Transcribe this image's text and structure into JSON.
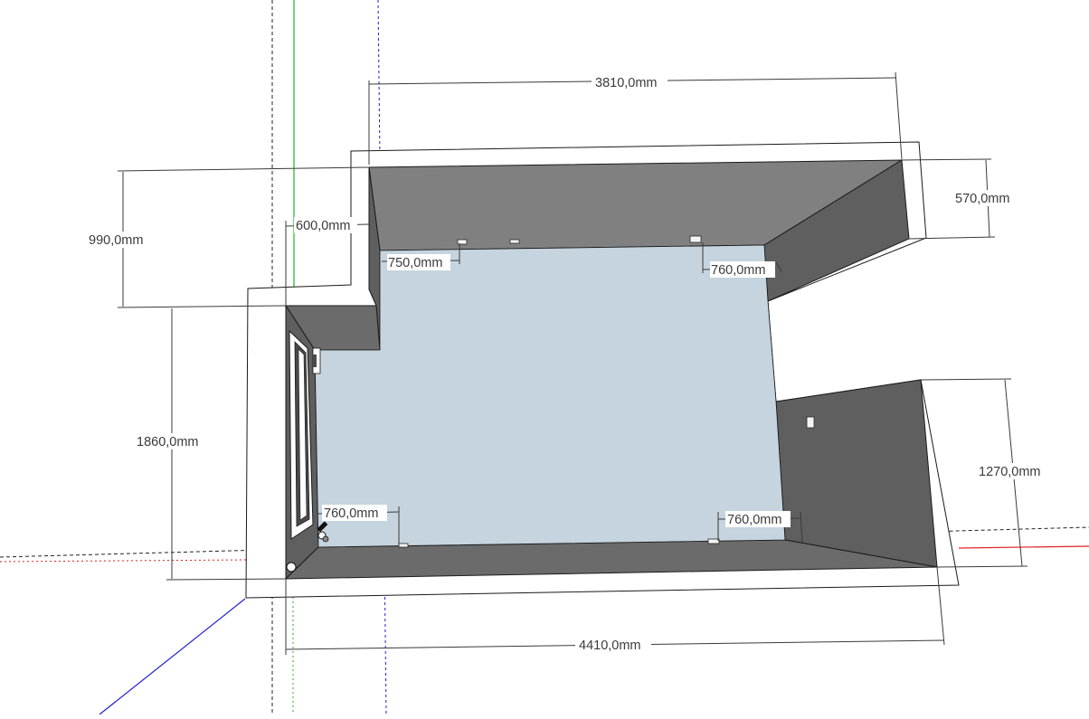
{
  "colors": {
    "floor": "#c5d4de",
    "wall_light": "#808080",
    "wall_dark": "#5f5f5f",
    "wall_mid": "#6b6b6b",
    "wall_top": "#ffffff",
    "axis_green": "#22b022",
    "axis_red": "#e02020",
    "axis_blue": "#2020d0",
    "dimension": "#3a3a3a"
  },
  "dimensions": {
    "top_width": "3810,0mm",
    "bottom_width": "4410,0mm",
    "left_upper_height": "990,0mm",
    "left_lower_height": "1860,0mm",
    "right_upper_height": "570,0mm",
    "right_lower_height": "1270,0mm",
    "inner_offset": "600,0mm",
    "outlet_top_left": "750,0mm",
    "outlet_top_right": "760,0mm",
    "outlet_bottom_left": "760,0mm",
    "outlet_bottom_right": "760,0mm"
  }
}
